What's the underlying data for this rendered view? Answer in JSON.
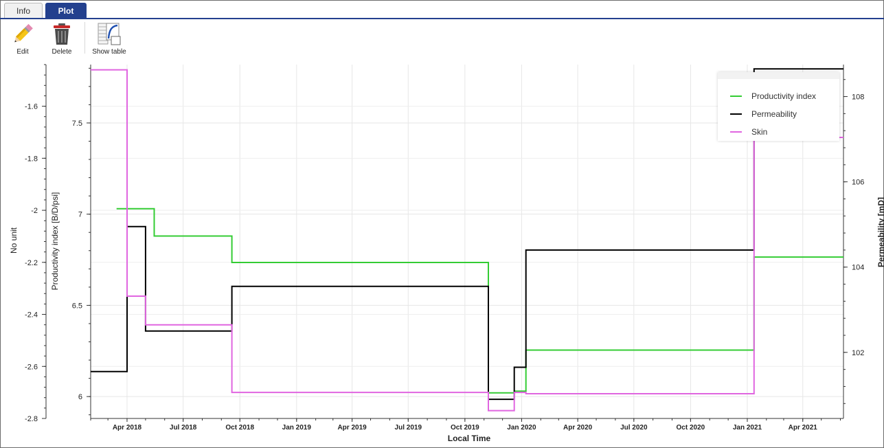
{
  "tabs": [
    {
      "label": "Info",
      "active": false
    },
    {
      "label": "Plot",
      "active": true
    }
  ],
  "toolbar": {
    "edit_label": "Edit",
    "delete_label": "Delete",
    "show_table_label": "Show table",
    "icons": {
      "edit": "pencil-icon",
      "delete": "trash-icon",
      "show_table": "table-curve-icon"
    }
  },
  "colors": {
    "accent": "#23408e",
    "productivity": "#33cc33",
    "permeability": "#000000",
    "skin": "#e065e0"
  },
  "chart_data": {
    "type": "line",
    "xlabel": "Local Time",
    "x_ticks": [
      "Apr 2018",
      "Jul 2018",
      "Oct 2018",
      "Jan 2019",
      "Apr 2019",
      "Jul 2019",
      "Oct 2019",
      "Jan 2020",
      "Apr 2020",
      "Jul 2020",
      "Oct 2020",
      "Jan 2021",
      "Apr 2021"
    ],
    "xlim": [
      "2018-02-01",
      "2021-06-06"
    ],
    "step": "after",
    "grid": true,
    "legend_position": "top-right",
    "axes": {
      "skin": {
        "label": "No unit",
        "side": "left-outer",
        "range": [
          -2.8,
          -1.44
        ],
        "ticks": [
          "-1.6",
          "-1.8",
          "-2",
          "-2.2",
          "-2.4",
          "-2.6",
          "-2.8"
        ],
        "tick_values": [
          -1.6,
          -1.8,
          -2.0,
          -2.2,
          -2.4,
          -2.6,
          -2.8
        ],
        "minor_step": 0.04
      },
      "productivity": {
        "label": "Productivity index [B/D/psi]",
        "side": "left-inner",
        "range": [
          5.88,
          7.82
        ],
        "ticks": [
          "7.5",
          "7",
          "6.5",
          "6"
        ],
        "tick_values": [
          7.5,
          7.0,
          6.5,
          6.0
        ],
        "minor_step": 0.1
      },
      "permeability": {
        "label": "Permeability [mD]",
        "side": "right",
        "range": [
          100.45,
          108.75
        ],
        "ticks": [
          "108",
          "106",
          "104",
          "102"
        ],
        "tick_values": [
          108,
          106,
          104,
          102
        ],
        "minor_step": 0.4
      }
    },
    "series": [
      {
        "name": "Productivity index",
        "axis": "productivity",
        "points": [
          {
            "x": "2018-03-15",
            "y": 7.03
          },
          {
            "x": "2018-05-15",
            "y": 6.88
          },
          {
            "x": "2018-09-18",
            "y": 6.735
          },
          {
            "x": "2019-11-08",
            "y": 6.02
          },
          {
            "x": "2019-12-20",
            "y": 6.03
          },
          {
            "x": "2020-01-08",
            "y": 6.255
          },
          {
            "x": "2021-01-12",
            "y": 6.765
          },
          {
            "x": "2021-06-06",
            "y": 6.765
          }
        ]
      },
      {
        "name": "Permeability",
        "axis": "permeability",
        "points": [
          {
            "x": "2018-02-01",
            "y": 101.55
          },
          {
            "x": "2018-04-01",
            "y": 104.95
          },
          {
            "x": "2018-05-01",
            "y": 102.5
          },
          {
            "x": "2018-09-18",
            "y": 103.55
          },
          {
            "x": "2019-11-08",
            "y": 100.9
          },
          {
            "x": "2019-12-20",
            "y": 101.65
          },
          {
            "x": "2020-01-08",
            "y": 104.4
          },
          {
            "x": "2021-01-12",
            "y": 108.65
          },
          {
            "x": "2021-06-06",
            "y": 108.65
          }
        ]
      },
      {
        "name": "Skin",
        "axis": "skin",
        "points": [
          {
            "x": "2018-02-01",
            "y": -1.46
          },
          {
            "x": "2018-04-01",
            "y": -2.33
          },
          {
            "x": "2018-05-01",
            "y": -2.44
          },
          {
            "x": "2018-09-18",
            "y": -2.7
          },
          {
            "x": "2019-11-08",
            "y": -2.77
          },
          {
            "x": "2019-12-20",
            "y": -2.7
          },
          {
            "x": "2020-01-08",
            "y": -2.705
          },
          {
            "x": "2021-01-12",
            "y": -1.72
          },
          {
            "x": "2021-06-06",
            "y": -1.72
          }
        ]
      }
    ]
  }
}
